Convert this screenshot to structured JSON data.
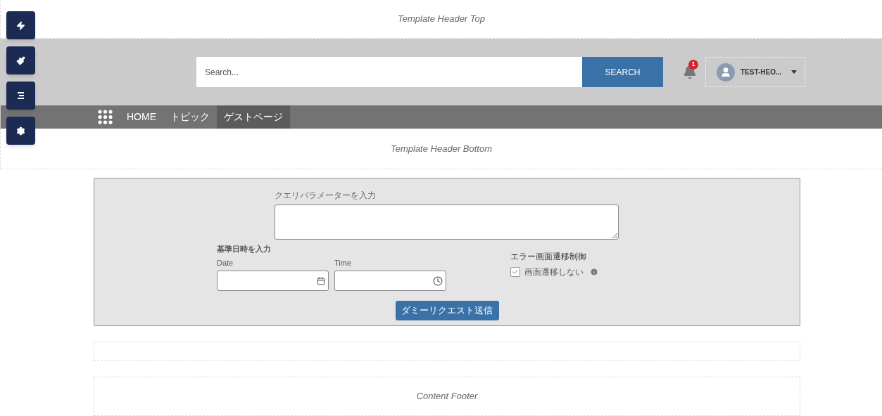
{
  "header_top": {
    "title": "Template Header Top"
  },
  "search": {
    "placeholder": "Search...",
    "button": "SEARCH"
  },
  "notifications": {
    "count": "1"
  },
  "user": {
    "name": "TEST-HEO..."
  },
  "nav": [
    {
      "label": "HOME",
      "selected": false
    },
    {
      "label": "トピック",
      "selected": false
    },
    {
      "label": "ゲストページ",
      "selected": true
    }
  ],
  "header_bottom": {
    "title": "Template Header Bottom"
  },
  "form": {
    "query_label": "クエリパラメーターを入力",
    "datetime_label": "基準日時を入力",
    "date_label": "Date",
    "time_label": "Time",
    "error_label": "エラー画面遷移制御",
    "checkbox": {
      "label": "画面遷移しない",
      "checked": true
    },
    "submit": "ダミーリクエスト送信"
  },
  "content_footer": {
    "title": "Content Footer"
  }
}
